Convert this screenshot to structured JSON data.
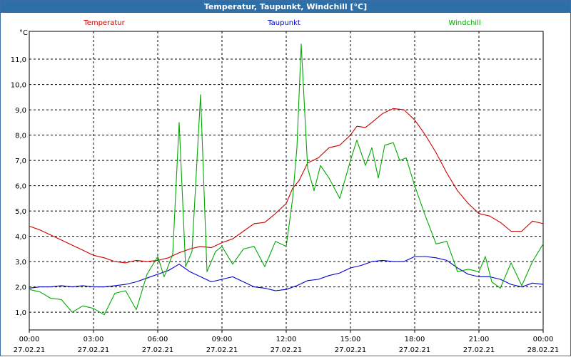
{
  "window": {
    "title": "Temperatur, Taupunkt, Windchill [°C]"
  },
  "chart_data": {
    "type": "line",
    "unit_label": "°C",
    "grid": true,
    "legend_position": "top",
    "xlim_hours": [
      0,
      24
    ],
    "ylim": [
      0.3,
      12.1
    ],
    "y_ticks": [
      {
        "value": 1.0,
        "label": "1,0"
      },
      {
        "value": 2.0,
        "label": "2,0"
      },
      {
        "value": 3.0,
        "label": "3,0"
      },
      {
        "value": 4.0,
        "label": "4,0"
      },
      {
        "value": 5.0,
        "label": "5,0"
      },
      {
        "value": 6.0,
        "label": "6,0"
      },
      {
        "value": 7.0,
        "label": "7,0"
      },
      {
        "value": 8.0,
        "label": "8,0"
      },
      {
        "value": 9.0,
        "label": "9,0"
      },
      {
        "value": 10.0,
        "label": "10,0"
      },
      {
        "value": 11.0,
        "label": "11,0"
      }
    ],
    "x_ticks": [
      {
        "hour": 0,
        "time": "00:00",
        "date": "27.02.21"
      },
      {
        "hour": 3,
        "time": "03:00",
        "date": "27.02.21"
      },
      {
        "hour": 6,
        "time": "06:00",
        "date": "27.02.21"
      },
      {
        "hour": 9,
        "time": "09:00",
        "date": "27.02.21"
      },
      {
        "hour": 12,
        "time": "12:00",
        "date": "27.02.21"
      },
      {
        "hour": 15,
        "time": "15:00",
        "date": "27.02.21"
      },
      {
        "hour": 18,
        "time": "18:00",
        "date": "27.02.21"
      },
      {
        "hour": 21,
        "time": "21:00",
        "date": "27.02.21"
      },
      {
        "hour": 24,
        "time": "00:00",
        "date": "28.02.21"
      }
    ],
    "series": [
      {
        "name": "Temperatur",
        "color": "#cc0000",
        "points": [
          [
            0,
            4.4
          ],
          [
            0.5,
            4.25
          ],
          [
            1,
            4.05
          ],
          [
            1.5,
            3.85
          ],
          [
            2,
            3.65
          ],
          [
            2.5,
            3.45
          ],
          [
            3,
            3.25
          ],
          [
            3.5,
            3.15
          ],
          [
            4,
            3.0
          ],
          [
            4.5,
            2.95
          ],
          [
            5,
            3.05
          ],
          [
            5.5,
            3.0
          ],
          [
            6,
            3.05
          ],
          [
            6.5,
            3.15
          ],
          [
            7,
            3.35
          ],
          [
            7.5,
            3.5
          ],
          [
            8,
            3.6
          ],
          [
            8.5,
            3.55
          ],
          [
            9,
            3.75
          ],
          [
            9.5,
            3.9
          ],
          [
            10,
            4.2
          ],
          [
            10.5,
            4.5
          ],
          [
            11,
            4.55
          ],
          [
            11.5,
            4.9
          ],
          [
            12,
            5.3
          ],
          [
            12.3,
            5.9
          ],
          [
            12.6,
            6.2
          ],
          [
            13,
            6.9
          ],
          [
            13.5,
            7.1
          ],
          [
            14,
            7.5
          ],
          [
            14.5,
            7.6
          ],
          [
            15,
            8.0
          ],
          [
            15.3,
            8.35
          ],
          [
            15.7,
            8.3
          ],
          [
            16,
            8.5
          ],
          [
            16.5,
            8.85
          ],
          [
            17,
            9.05
          ],
          [
            17.5,
            9.0
          ],
          [
            18,
            8.6
          ],
          [
            18.5,
            8.0
          ],
          [
            19,
            7.3
          ],
          [
            19.5,
            6.5
          ],
          [
            20,
            5.8
          ],
          [
            20.5,
            5.3
          ],
          [
            21,
            4.9
          ],
          [
            21.5,
            4.8
          ],
          [
            22,
            4.55
          ],
          [
            22.5,
            4.2
          ],
          [
            23,
            4.2
          ],
          [
            23.5,
            4.6
          ],
          [
            24,
            4.5
          ]
        ]
      },
      {
        "name": "Taupunkt",
        "color": "#0000cc",
        "points": [
          [
            0,
            1.95
          ],
          [
            0.5,
            2.0
          ],
          [
            1,
            2.0
          ],
          [
            1.5,
            2.05
          ],
          [
            2,
            2.0
          ],
          [
            2.5,
            2.05
          ],
          [
            3,
            2.0
          ],
          [
            3.5,
            2.0
          ],
          [
            4,
            2.05
          ],
          [
            4.5,
            2.1
          ],
          [
            5,
            2.2
          ],
          [
            5.5,
            2.35
          ],
          [
            6,
            2.5
          ],
          [
            6.5,
            2.65
          ],
          [
            7,
            2.9
          ],
          [
            7.5,
            2.6
          ],
          [
            8,
            2.4
          ],
          [
            8.5,
            2.2
          ],
          [
            9,
            2.3
          ],
          [
            9.5,
            2.4
          ],
          [
            10,
            2.2
          ],
          [
            10.5,
            2.0
          ],
          [
            11,
            1.95
          ],
          [
            11.5,
            1.85
          ],
          [
            12,
            1.9
          ],
          [
            12.5,
            2.05
          ],
          [
            13,
            2.25
          ],
          [
            13.5,
            2.3
          ],
          [
            14,
            2.45
          ],
          [
            14.5,
            2.55
          ],
          [
            15,
            2.75
          ],
          [
            15.5,
            2.85
          ],
          [
            16,
            3.0
          ],
          [
            16.5,
            3.05
          ],
          [
            17,
            3.0
          ],
          [
            17.5,
            3.0
          ],
          [
            18,
            3.2
          ],
          [
            18.5,
            3.2
          ],
          [
            19,
            3.15
          ],
          [
            19.5,
            3.05
          ],
          [
            20,
            2.75
          ],
          [
            20.5,
            2.5
          ],
          [
            21,
            2.4
          ],
          [
            21.5,
            2.4
          ],
          [
            22,
            2.3
          ],
          [
            22.5,
            2.1
          ],
          [
            23,
            2.0
          ],
          [
            23.5,
            2.15
          ],
          [
            24,
            2.1
          ]
        ]
      },
      {
        "name": "Windchill",
        "color": "#00aa00",
        "points": [
          [
            0,
            1.9
          ],
          [
            0.5,
            1.8
          ],
          [
            1,
            1.55
          ],
          [
            1.5,
            1.5
          ],
          [
            2,
            1.0
          ],
          [
            2.5,
            1.25
          ],
          [
            3,
            1.15
          ],
          [
            3.5,
            0.9
          ],
          [
            4,
            1.75
          ],
          [
            4.5,
            1.85
          ],
          [
            5,
            1.1
          ],
          [
            5.5,
            2.5
          ],
          [
            6,
            3.2
          ],
          [
            6.3,
            2.4
          ],
          [
            6.7,
            3.3
          ],
          [
            7,
            8.5
          ],
          [
            7.3,
            2.8
          ],
          [
            7.6,
            3.4
          ],
          [
            8,
            9.6
          ],
          [
            8.3,
            2.6
          ],
          [
            8.7,
            3.4
          ],
          [
            9,
            3.6
          ],
          [
            9.5,
            2.9
          ],
          [
            10,
            3.5
          ],
          [
            10.5,
            3.6
          ],
          [
            11,
            2.8
          ],
          [
            11.5,
            3.8
          ],
          [
            12,
            3.6
          ],
          [
            12.3,
            5.5
          ],
          [
            12.5,
            7.5
          ],
          [
            12.7,
            11.6
          ],
          [
            13,
            6.7
          ],
          [
            13.3,
            5.8
          ],
          [
            13.6,
            6.8
          ],
          [
            14,
            6.3
          ],
          [
            14.5,
            5.5
          ],
          [
            15,
            7.0
          ],
          [
            15.3,
            7.8
          ],
          [
            15.7,
            6.8
          ],
          [
            16,
            7.5
          ],
          [
            16.3,
            6.3
          ],
          [
            16.6,
            7.6
          ],
          [
            17,
            7.7
          ],
          [
            17.3,
            7.0
          ],
          [
            17.6,
            7.1
          ],
          [
            18,
            6.0
          ],
          [
            18.5,
            4.8
          ],
          [
            19,
            3.7
          ],
          [
            19.5,
            3.8
          ],
          [
            20,
            2.6
          ],
          [
            20.5,
            2.7
          ],
          [
            21,
            2.6
          ],
          [
            21.3,
            3.2
          ],
          [
            21.6,
            2.2
          ],
          [
            22,
            1.95
          ],
          [
            22.5,
            2.95
          ],
          [
            23,
            2.05
          ],
          [
            23.5,
            3.0
          ],
          [
            24,
            3.7
          ]
        ]
      }
    ]
  }
}
